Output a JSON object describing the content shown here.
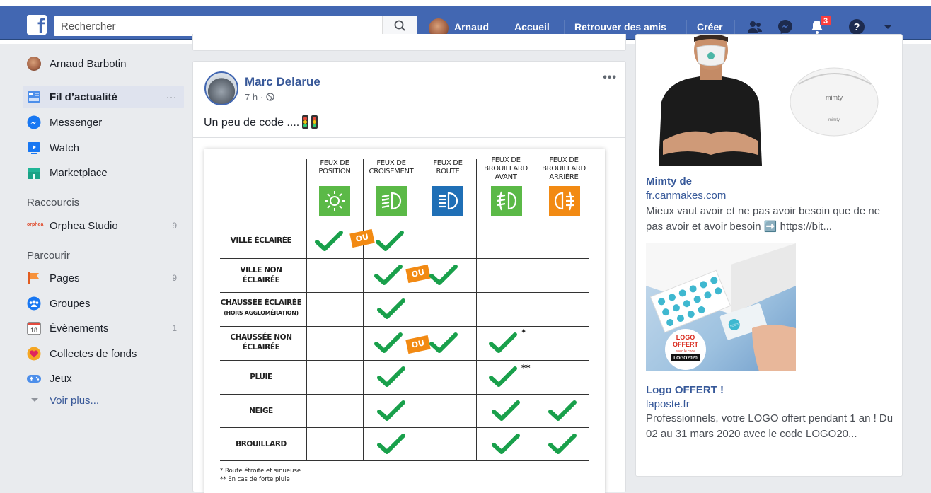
{
  "header": {
    "search_placeholder": "Rechercher",
    "user_name": "Arnaud",
    "nav": [
      "Accueil",
      "Retrouver des amis",
      "Créer"
    ],
    "notifications_count": "3"
  },
  "sidebar": {
    "user": "Arnaud Barbotin",
    "items": [
      {
        "label": "Fil d’actualité",
        "extra": "···"
      },
      {
        "label": "Messenger"
      },
      {
        "label": "Watch"
      },
      {
        "label": "Marketplace"
      }
    ],
    "shortcuts_title": "Raccourcis",
    "shortcuts": [
      {
        "label": "Orphea Studio",
        "count": "9",
        "logo_text": "orphea"
      }
    ],
    "explore_title": "Parcourir",
    "explore": [
      {
        "label": "Pages",
        "count": "9"
      },
      {
        "label": "Groupes"
      },
      {
        "label": "Évènements",
        "count": "1",
        "cal_day": "18"
      },
      {
        "label": "Collectes de fonds"
      },
      {
        "label": "Jeux"
      }
    ],
    "see_more": "Voir plus..."
  },
  "post": {
    "author": "Marc Delarue",
    "meta": "7 h · ",
    "text": "Un peu de code ....",
    "more": "•••",
    "table": {
      "headers": [
        "FEUX DE POSITION",
        "FEUX DE CROISEMENT",
        "FEUX DE ROUTE",
        "FEUX DE BROUILLARD AVANT",
        "FEUX DE BROUILLARD ARRIÈRE"
      ],
      "lamp_colors": [
        "#5bb947",
        "#5bb947",
        "#1f6fb6",
        "#5bb947",
        "#f28a13"
      ],
      "rows": [
        {
          "label": "VILLE ÉCLAIRÉE",
          "sub": ""
        },
        {
          "label": "VILLE NON ÉCLAIRÉE",
          "sub": ""
        },
        {
          "label": "CHAUSSÉE ÉCLAIRÉE",
          "sub": "(HORS AGGLOMÉRATION)"
        },
        {
          "label": "CHAUSSÉE NON ÉCLAIRÉE",
          "sub": ""
        },
        {
          "label": "PLUIE",
          "sub": ""
        },
        {
          "label": "NEIGE",
          "sub": ""
        },
        {
          "label": "BROUILLARD",
          "sub": ""
        }
      ],
      "ou_label": "OU",
      "star1": "*",
      "star2": "**",
      "footnotes": [
        "*  Route étroite et sinueuse",
        "** En cas de forte pluie"
      ]
    }
  },
  "ads": [
    {
      "title": "Mimty de",
      "url": "fr.canmakes.com",
      "desc": "Mieux vaut avoir et ne pas avoir besoin que de ne pas avoir et avoir besoin ➡️ https://bit...",
      "brand": "mimty"
    },
    {
      "title": "Logo OFFERT !",
      "url": "laposte.fr",
      "desc": "Professionnels, votre LOGO offert pendant 1 an ! Du 02 au 31 mars 2020 avec le code LOGO20...",
      "sticker_lines": [
        "LOGO",
        "OFFERT",
        "avec le code",
        "LOGO2020"
      ],
      "card_text": "LOGO"
    }
  ]
}
